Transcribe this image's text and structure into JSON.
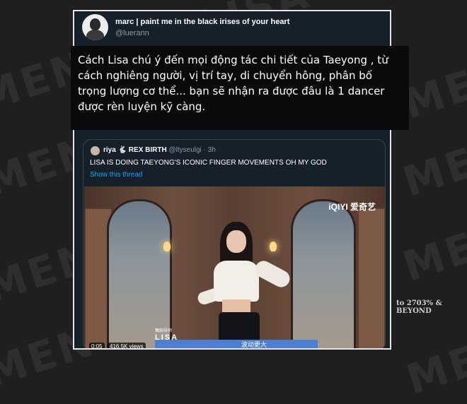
{
  "watermark": {
    "text": "MENTOR LISA",
    "brand": "to 2703% & BEYOND"
  },
  "tweet": {
    "author_name": "marc | paint me in the black irises of your heart",
    "author_handle": "@luerann"
  },
  "caption": {
    "text": "Cách Lisa chú ý đến mọi động tác chi tiết của Taeyong , từ cách nghiêng người, vị trí tay, di chuyển hông, phân bố trọng lượng cơ thể... bạn sẽ nhận ra được đâu là 1 dancer được rèn luyện kỹ càng."
  },
  "quoted": {
    "name": "riya 🐇 REX BIRTH",
    "handle": "@ltyseulgi",
    "time": "· 3h",
    "text": "LISA IS DOING TAEYONG'S ICONIC FINGER MOVEMENTS OH MY GOD",
    "show_thread": "Show this thread"
  },
  "video": {
    "logo": "iQIYI 爱奇艺",
    "overlay_small": "舞蹈导师",
    "overlay_name": "LISA",
    "overlay_sub": "波动更大",
    "time": "0:05",
    "views": "416.5K views"
  },
  "colors": {
    "background": "#1f1f1f",
    "card": "#15202b",
    "link": "#1da1f2"
  }
}
